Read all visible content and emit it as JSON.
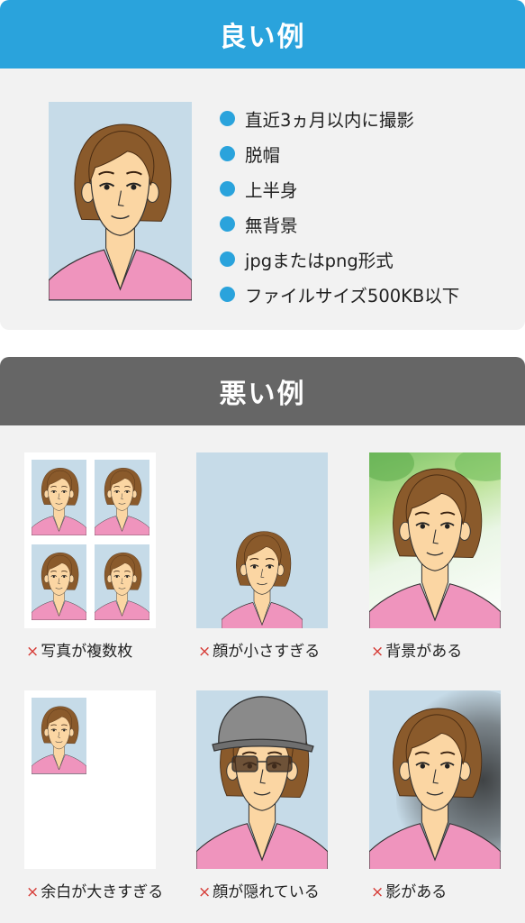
{
  "good": {
    "title": "良い例",
    "requirements": [
      "直近3ヵ月以内に撮影",
      "脱帽",
      "上半身",
      "無背景",
      "jpgまたはpng形式",
      "ファイルサイズ500KB以下"
    ]
  },
  "bad": {
    "title": "悪い例",
    "mark": "×",
    "examples": [
      "写真が複数枚",
      "顔が小さすぎる",
      "背景がある",
      "余白が大きすぎる",
      "顔が隠れている",
      "影がある"
    ]
  },
  "colors": {
    "good_header": "#2aa3dc",
    "bad_header": "#666666",
    "bullet": "#2aa3dc",
    "cross": "#d63a35",
    "photo_background": "#c6dbe8",
    "shirt": "#ef94bd",
    "hair": "#8a5a2b",
    "skin": "#fbd6a3"
  }
}
